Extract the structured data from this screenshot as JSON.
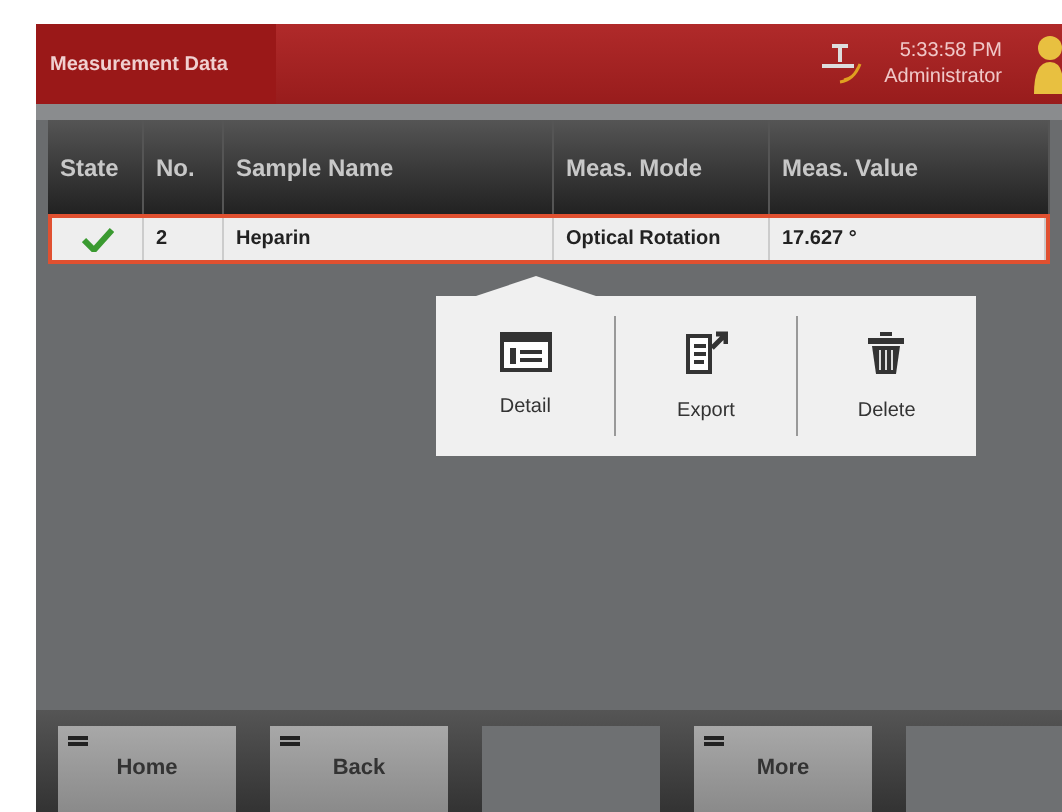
{
  "header": {
    "title": "Measurement Data",
    "time": "5:33:58 PM",
    "user": "Administrator"
  },
  "table": {
    "columns": [
      "State",
      "No.",
      "Sample Name",
      "Meas. Mode",
      "Meas. Value"
    ],
    "rows": [
      {
        "selected": true,
        "ok": true,
        "cells": [
          "",
          "2",
          "Heparin",
          "Optical Rotation",
          "17.627 °"
        ]
      }
    ]
  },
  "popup": {
    "items": [
      {
        "kind": "detail",
        "label": "Detail"
      },
      {
        "kind": "export",
        "label": "Export"
      },
      {
        "kind": "delete",
        "label": "Delete"
      }
    ]
  },
  "footer": {
    "buttons": [
      {
        "label": "Home",
        "disabled": false
      },
      {
        "label": "Back",
        "disabled": false
      },
      {
        "disabled": true
      },
      {
        "label": "More",
        "disabled": false
      },
      {
        "disabled": true
      }
    ]
  }
}
